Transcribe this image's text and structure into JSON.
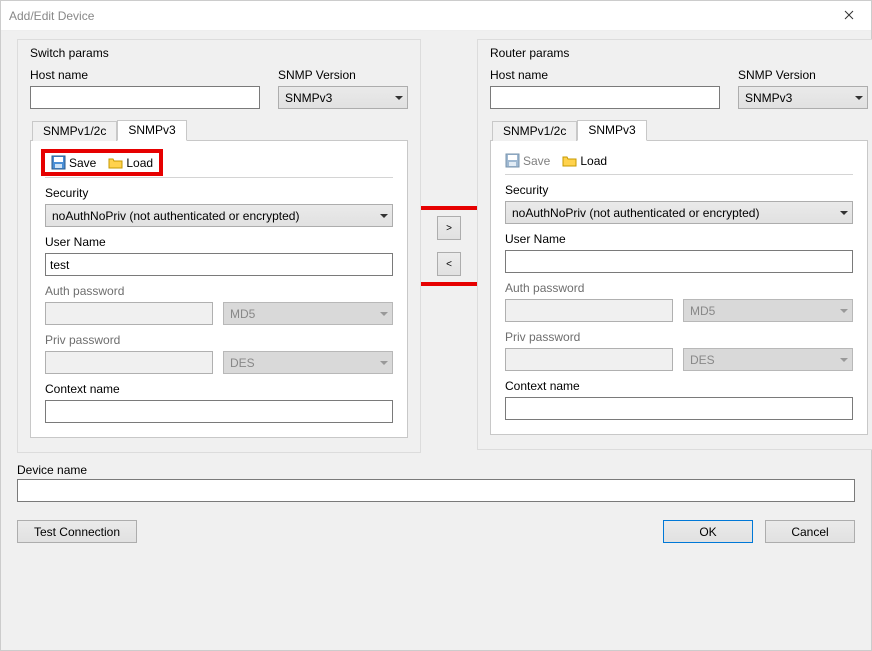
{
  "title": "Add/Edit Device",
  "switch": {
    "legend": "Switch params",
    "host_label": "Host name",
    "host_value": "",
    "snmpver_label": "SNMP Version",
    "snmpver_value": "SNMPv3",
    "tabs": {
      "v12c": "SNMPv1/2c",
      "v3": "SNMPv3"
    },
    "toolbar": {
      "save": "Save",
      "load": "Load"
    },
    "security_label": "Security",
    "security_value": "noAuthNoPriv (not authenticated or encrypted)",
    "username_label": "User Name",
    "username_value": "test",
    "authpw_label": "Auth password",
    "authalgo_value": "MD5",
    "privpw_label": "Priv password",
    "privalgo_value": "DES",
    "context_label": "Context name",
    "context_value": ""
  },
  "router": {
    "legend": "Router params",
    "host_label": "Host name",
    "host_value": "",
    "snmpver_label": "SNMP Version",
    "snmpver_value": "SNMPv3",
    "tabs": {
      "v12c": "SNMPv1/2c",
      "v3": "SNMPv3"
    },
    "toolbar": {
      "save": "Save",
      "load": "Load"
    },
    "security_label": "Security",
    "security_value": "noAuthNoPriv (not authenticated or encrypted)",
    "username_label": "User Name",
    "username_value": "",
    "authpw_label": "Auth password",
    "authalgo_value": "MD5",
    "privpw_label": "Priv password",
    "privalgo_value": "DES",
    "context_label": "Context name",
    "context_value": ""
  },
  "arrows": {
    "right": ">",
    "left": "<"
  },
  "device_name_label": "Device name",
  "device_name_value": "",
  "buttons": {
    "test": "Test Connection",
    "ok": "OK",
    "cancel": "Cancel"
  }
}
